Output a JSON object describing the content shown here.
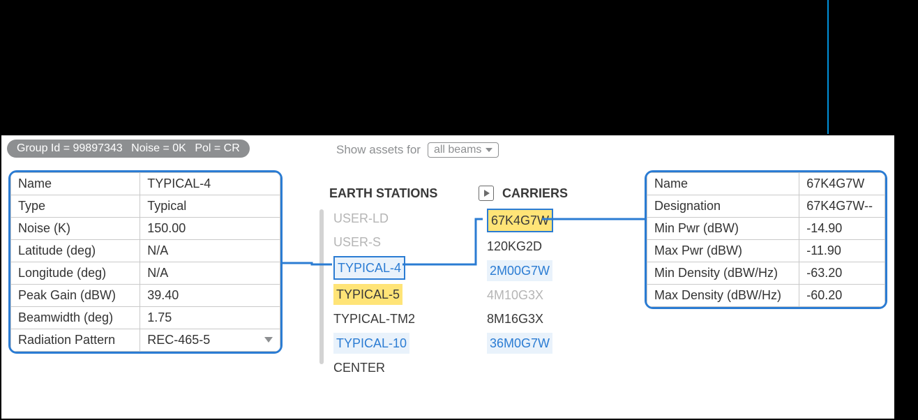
{
  "header": {
    "group_id_label": "Group Id = 99897343",
    "noise_label": "Noise = 0K",
    "pol_label": "Pol = CR",
    "show_assets_label": "Show assets for",
    "beam_selected": "all beams"
  },
  "left_props": {
    "rows": [
      {
        "key": "Name",
        "val": "TYPICAL-4"
      },
      {
        "key": "Type",
        "val": "Typical"
      },
      {
        "key": "Noise (K)",
        "val": "150.00"
      },
      {
        "key": "Latitude (deg)",
        "val": "N/A"
      },
      {
        "key": "Longitude (deg)",
        "val": "N/A"
      },
      {
        "key": "Peak Gain (dBW)",
        "val": "39.40"
      },
      {
        "key": "Beamwidth (deg)",
        "val": "1.75"
      },
      {
        "key": "Radiation Pattern",
        "val": "REC-465-5"
      }
    ]
  },
  "center": {
    "earth_stations_heading": "EARTH STATIONS",
    "carriers_heading": "CARRIERS",
    "earth_stations": [
      {
        "label": "USER-LD",
        "style": "faded"
      },
      {
        "label": "USER-S",
        "style": "faded"
      },
      {
        "label": "TYPICAL-4",
        "style": "sel-blue"
      },
      {
        "label": "TYPICAL-5",
        "style": "hl-yellow"
      },
      {
        "label": "TYPICAL-TM2",
        "style": ""
      },
      {
        "label": "TYPICAL-10",
        "style": "lt-blue"
      },
      {
        "label": "CENTER",
        "style": ""
      }
    ],
    "carriers": [
      {
        "label": "67K4G7W",
        "style": "sel-yellow"
      },
      {
        "label": "120KG2D",
        "style": ""
      },
      {
        "label": "2M00G7W",
        "style": "lt-blue"
      },
      {
        "label": "4M10G3X",
        "style": "faded"
      },
      {
        "label": "8M16G3X",
        "style": ""
      },
      {
        "label": "36M0G7W",
        "style": "lt-blue"
      }
    ]
  },
  "right_props": {
    "rows": [
      {
        "key": "Name",
        "val": "67K4G7W"
      },
      {
        "key": "Designation",
        "val": "67K4G7W--"
      },
      {
        "key": "Min Pwr (dBW)",
        "val": "-14.90"
      },
      {
        "key": "Max Pwr (dBW)",
        "val": "-11.90"
      },
      {
        "key": "Min Density (dBW/Hz)",
        "val": "-63.20"
      },
      {
        "key": "Max Density (dBW/Hz)",
        "val": "-60.20"
      }
    ]
  }
}
